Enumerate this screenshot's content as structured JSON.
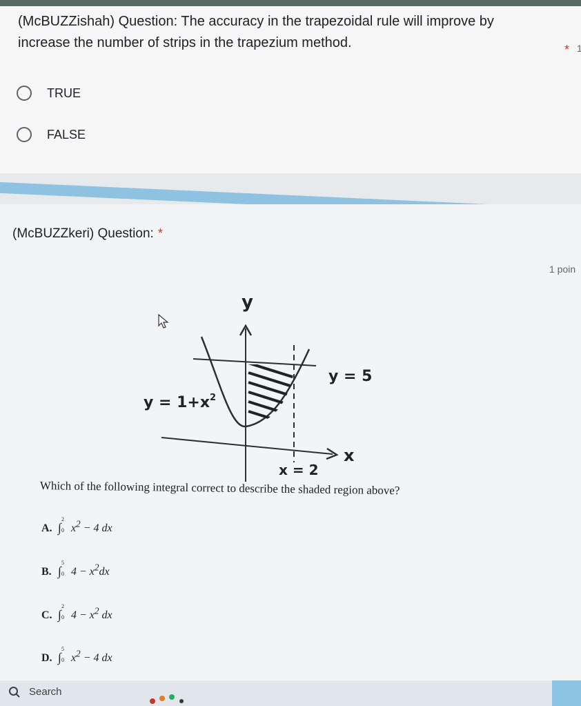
{
  "question1": {
    "title": "(McBUZZishah) Question: The accuracy in the trapezoidal rule will improve by increase the number of strips in the trapezium method.",
    "required_mark": "*",
    "points_fragment": "1",
    "options": [
      {
        "label": "TRUE"
      },
      {
        "label": "FALSE"
      }
    ]
  },
  "question2": {
    "title": "(McBUZZkeri) Question:",
    "required_mark": "*",
    "points": "1 poin",
    "graph": {
      "y_axis_label": "y",
      "x_axis_label": "x",
      "curve_label": "y = 1+x",
      "curve_label_exp": "2",
      "line_label": "y = 5",
      "bound_label": "x = 2"
    },
    "prompt": "Which of the following integral correct to describe the shaded region above?",
    "choices": [
      {
        "letter": "A.",
        "upper": "2",
        "lower": "0",
        "expr_a": "x",
        "exp": "2",
        "expr_b": " − 4 dx"
      },
      {
        "letter": "B.",
        "upper": "5",
        "lower": "0",
        "expr_a": "4 − x",
        "exp": "2",
        "expr_b": "dx"
      },
      {
        "letter": "C.",
        "upper": "2",
        "lower": "0",
        "expr_a": "4 − x",
        "exp": "2",
        "expr_b": " dx"
      },
      {
        "letter": "D.",
        "upper": "5",
        "lower": "0",
        "expr_a": "x",
        "exp": "2",
        "expr_b": " − 4 dx"
      }
    ]
  },
  "taskbar": {
    "search_label": "Search"
  },
  "colors": {
    "accent_band": "#8fc2e1",
    "required": "#d93025"
  }
}
